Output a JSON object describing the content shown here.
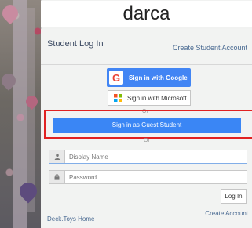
{
  "app": {
    "title": "darca"
  },
  "login_panel": {
    "heading": "Student Log In",
    "create_student_link": "Create Student Account",
    "google_button": "Sign in with Google",
    "microsoft_button": "Sign in with Microsoft",
    "or_text_1": "Or",
    "guest_button": "Sign in as Guest Student",
    "or_text_2": "Or",
    "display_name": {
      "placeholder": "Display Name",
      "value": ""
    },
    "password": {
      "placeholder": "Password",
      "value": ""
    },
    "login_button": "Log In",
    "home_link": "Deck.Toys Home",
    "create_account_link": "Create Account"
  },
  "icons": {
    "google": "google-icon",
    "microsoft": "microsoft-icon",
    "user": "user-icon",
    "lock": "lock-icon"
  },
  "colors": {
    "primary_blue": "#3a86f5",
    "google_blue": "#4285f4",
    "highlight_red": "#e02222",
    "link_blue": "#4a6a92"
  }
}
